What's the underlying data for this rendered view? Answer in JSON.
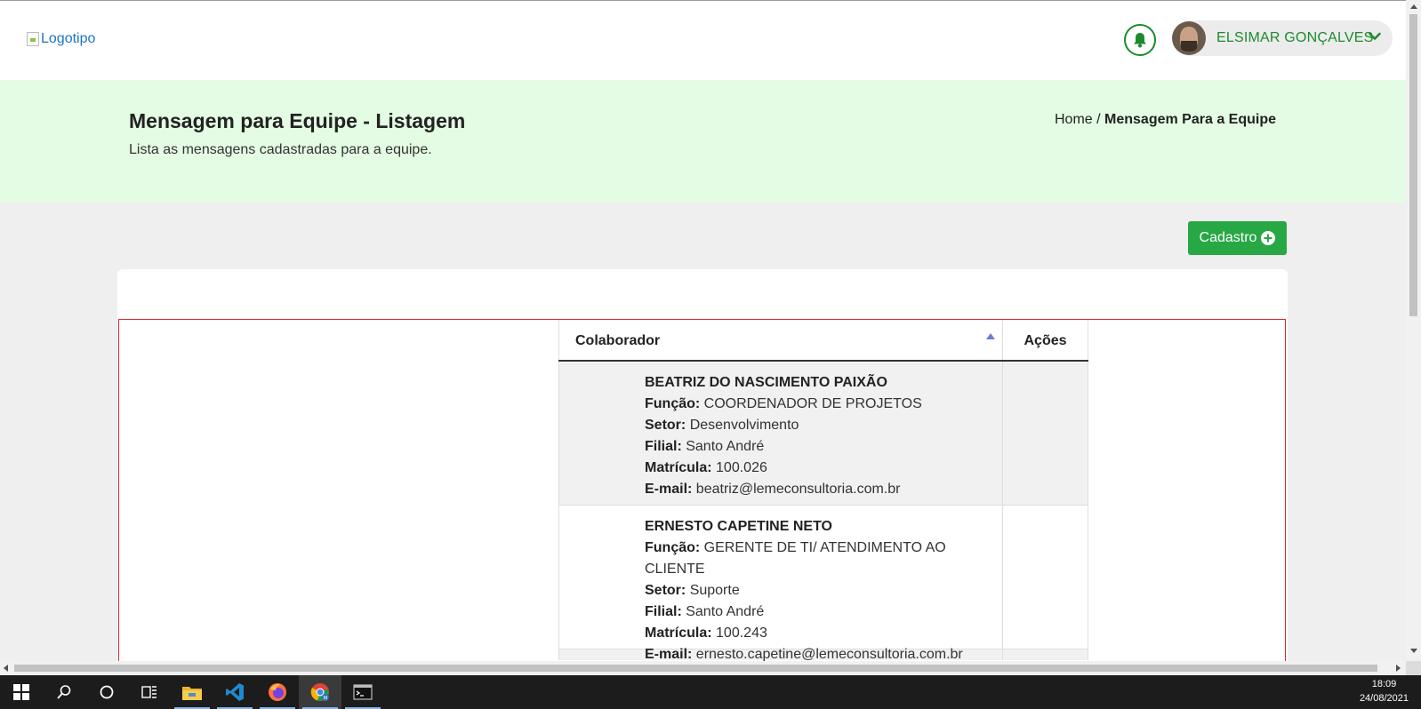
{
  "header": {
    "logo_alt": "Logotipo",
    "user_name": "ELSIMAR GONÇALVES"
  },
  "page": {
    "title": "Mensagem para Equipe - Listagem",
    "subtitle": "Lista as mensagens cadastradas para a equipe.",
    "breadcrumb_home": "Home /",
    "breadcrumb_current": "Mensagem Para a Equipe"
  },
  "actions": {
    "cadastro_label": "Cadastro"
  },
  "table": {
    "headers": [
      "Colaborador",
      "Ações"
    ],
    "rows": [
      {
        "name": "BEATRIZ DO NASCIMENTO PAIXÃO",
        "funcao_label": "Função:",
        "funcao": "COORDENADOR DE PROJETOS",
        "setor_label": "Setor:",
        "setor": "Desenvolvimento",
        "filial_label": "Filial:",
        "filial": "Santo André",
        "matricula_label": "Matrícula:",
        "matricula": "100.026",
        "email_label": "E-mail:",
        "email": "beatriz@lemeconsultoria.com.br"
      },
      {
        "name": "ERNESTO CAPETINE NETO",
        "funcao_label": "Função:",
        "funcao": "GERENTE DE TI/ ATENDIMENTO AO CLIENTE",
        "setor_label": "Setor:",
        "setor": "Suporte",
        "filial_label": "Filial:",
        "filial": "Santo André",
        "matricula_label": "Matrícula:",
        "matricula": "100.243",
        "email_label": "E-mail:",
        "email": "ernesto.capetine@lemeconsultoria.com.br"
      }
    ]
  },
  "taskbar": {
    "time": "18:09",
    "date": "24/08/2021",
    "icons": [
      "windows-start-icon",
      "search-icon",
      "cortana-icon",
      "task-view-icon",
      "file-explorer-icon",
      "vscode-icon",
      "firefox-icon",
      "chrome-icon",
      "terminal-icon"
    ]
  },
  "colors": {
    "accent_green": "#1e8a2e",
    "button_green": "#28a745",
    "hero_bg": "#e3fce3",
    "highlight_border": "#e0282e"
  }
}
